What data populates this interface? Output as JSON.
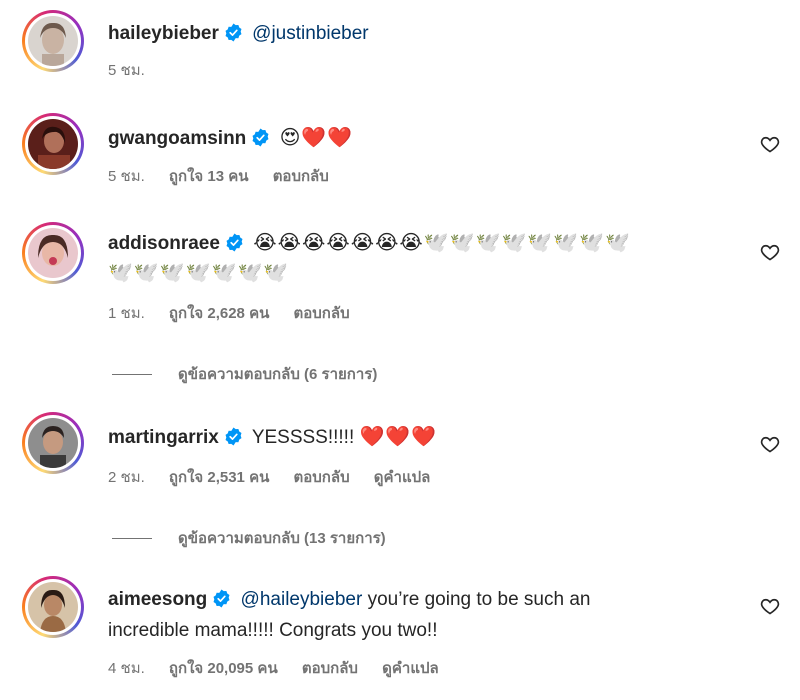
{
  "comments": [
    {
      "username": "haileybieber",
      "mention": "@justinbieber",
      "text": "",
      "emoji": "",
      "time": "5 ชม.",
      "likes": "",
      "reply": "",
      "translate": ""
    },
    {
      "username": "gwangoamsinn",
      "mention": "",
      "text": "",
      "emoji": "😍❤️❤️",
      "time": "5 ชม.",
      "likes": "ถูกใจ 13 คน",
      "reply": "ตอบกลับ",
      "translate": ""
    },
    {
      "username": "addisonraee",
      "mention": "",
      "text": "",
      "emoji": "😭😭😭😭😭😭😭🕊️🕊️🕊️🕊️🕊️🕊️🕊️🕊️",
      "emoji2": "🕊️🕊️🕊️🕊️🕊️🕊️🕊️",
      "time": "1 ชม.",
      "likes": "ถูกใจ 2,628 คน",
      "reply": "ตอบกลับ",
      "translate": "",
      "view_replies": "ดูข้อความตอบกลับ (6 รายการ)"
    },
    {
      "username": "martingarrix",
      "mention": "",
      "text": "YESSSS!!!!!",
      "emoji": "❤️❤️❤️",
      "time": "2 ชม.",
      "likes": "ถูกใจ 2,531 คน",
      "reply": "ตอบกลับ",
      "translate": "ดูคำแปล",
      "view_replies": "ดูข้อความตอบกลับ (13 รายการ)"
    },
    {
      "username": "aimeesong",
      "mention": "@haileybieber",
      "text": "you’re going to be such an",
      "text2": "incredible mama!!!!! Congrats you two!!",
      "emoji": "",
      "time": "4 ชม.",
      "likes": "ถูกใจ 20,095 คน",
      "reply": "ตอบกลับ",
      "translate": "ดูคำแปล"
    }
  ],
  "colors": {
    "verified": "#0095f6",
    "mention": "#00376b",
    "meta": "#737373",
    "text": "#262626"
  },
  "icons": {
    "verified": "verified-badge-icon",
    "like": "heart-outline-icon"
  }
}
